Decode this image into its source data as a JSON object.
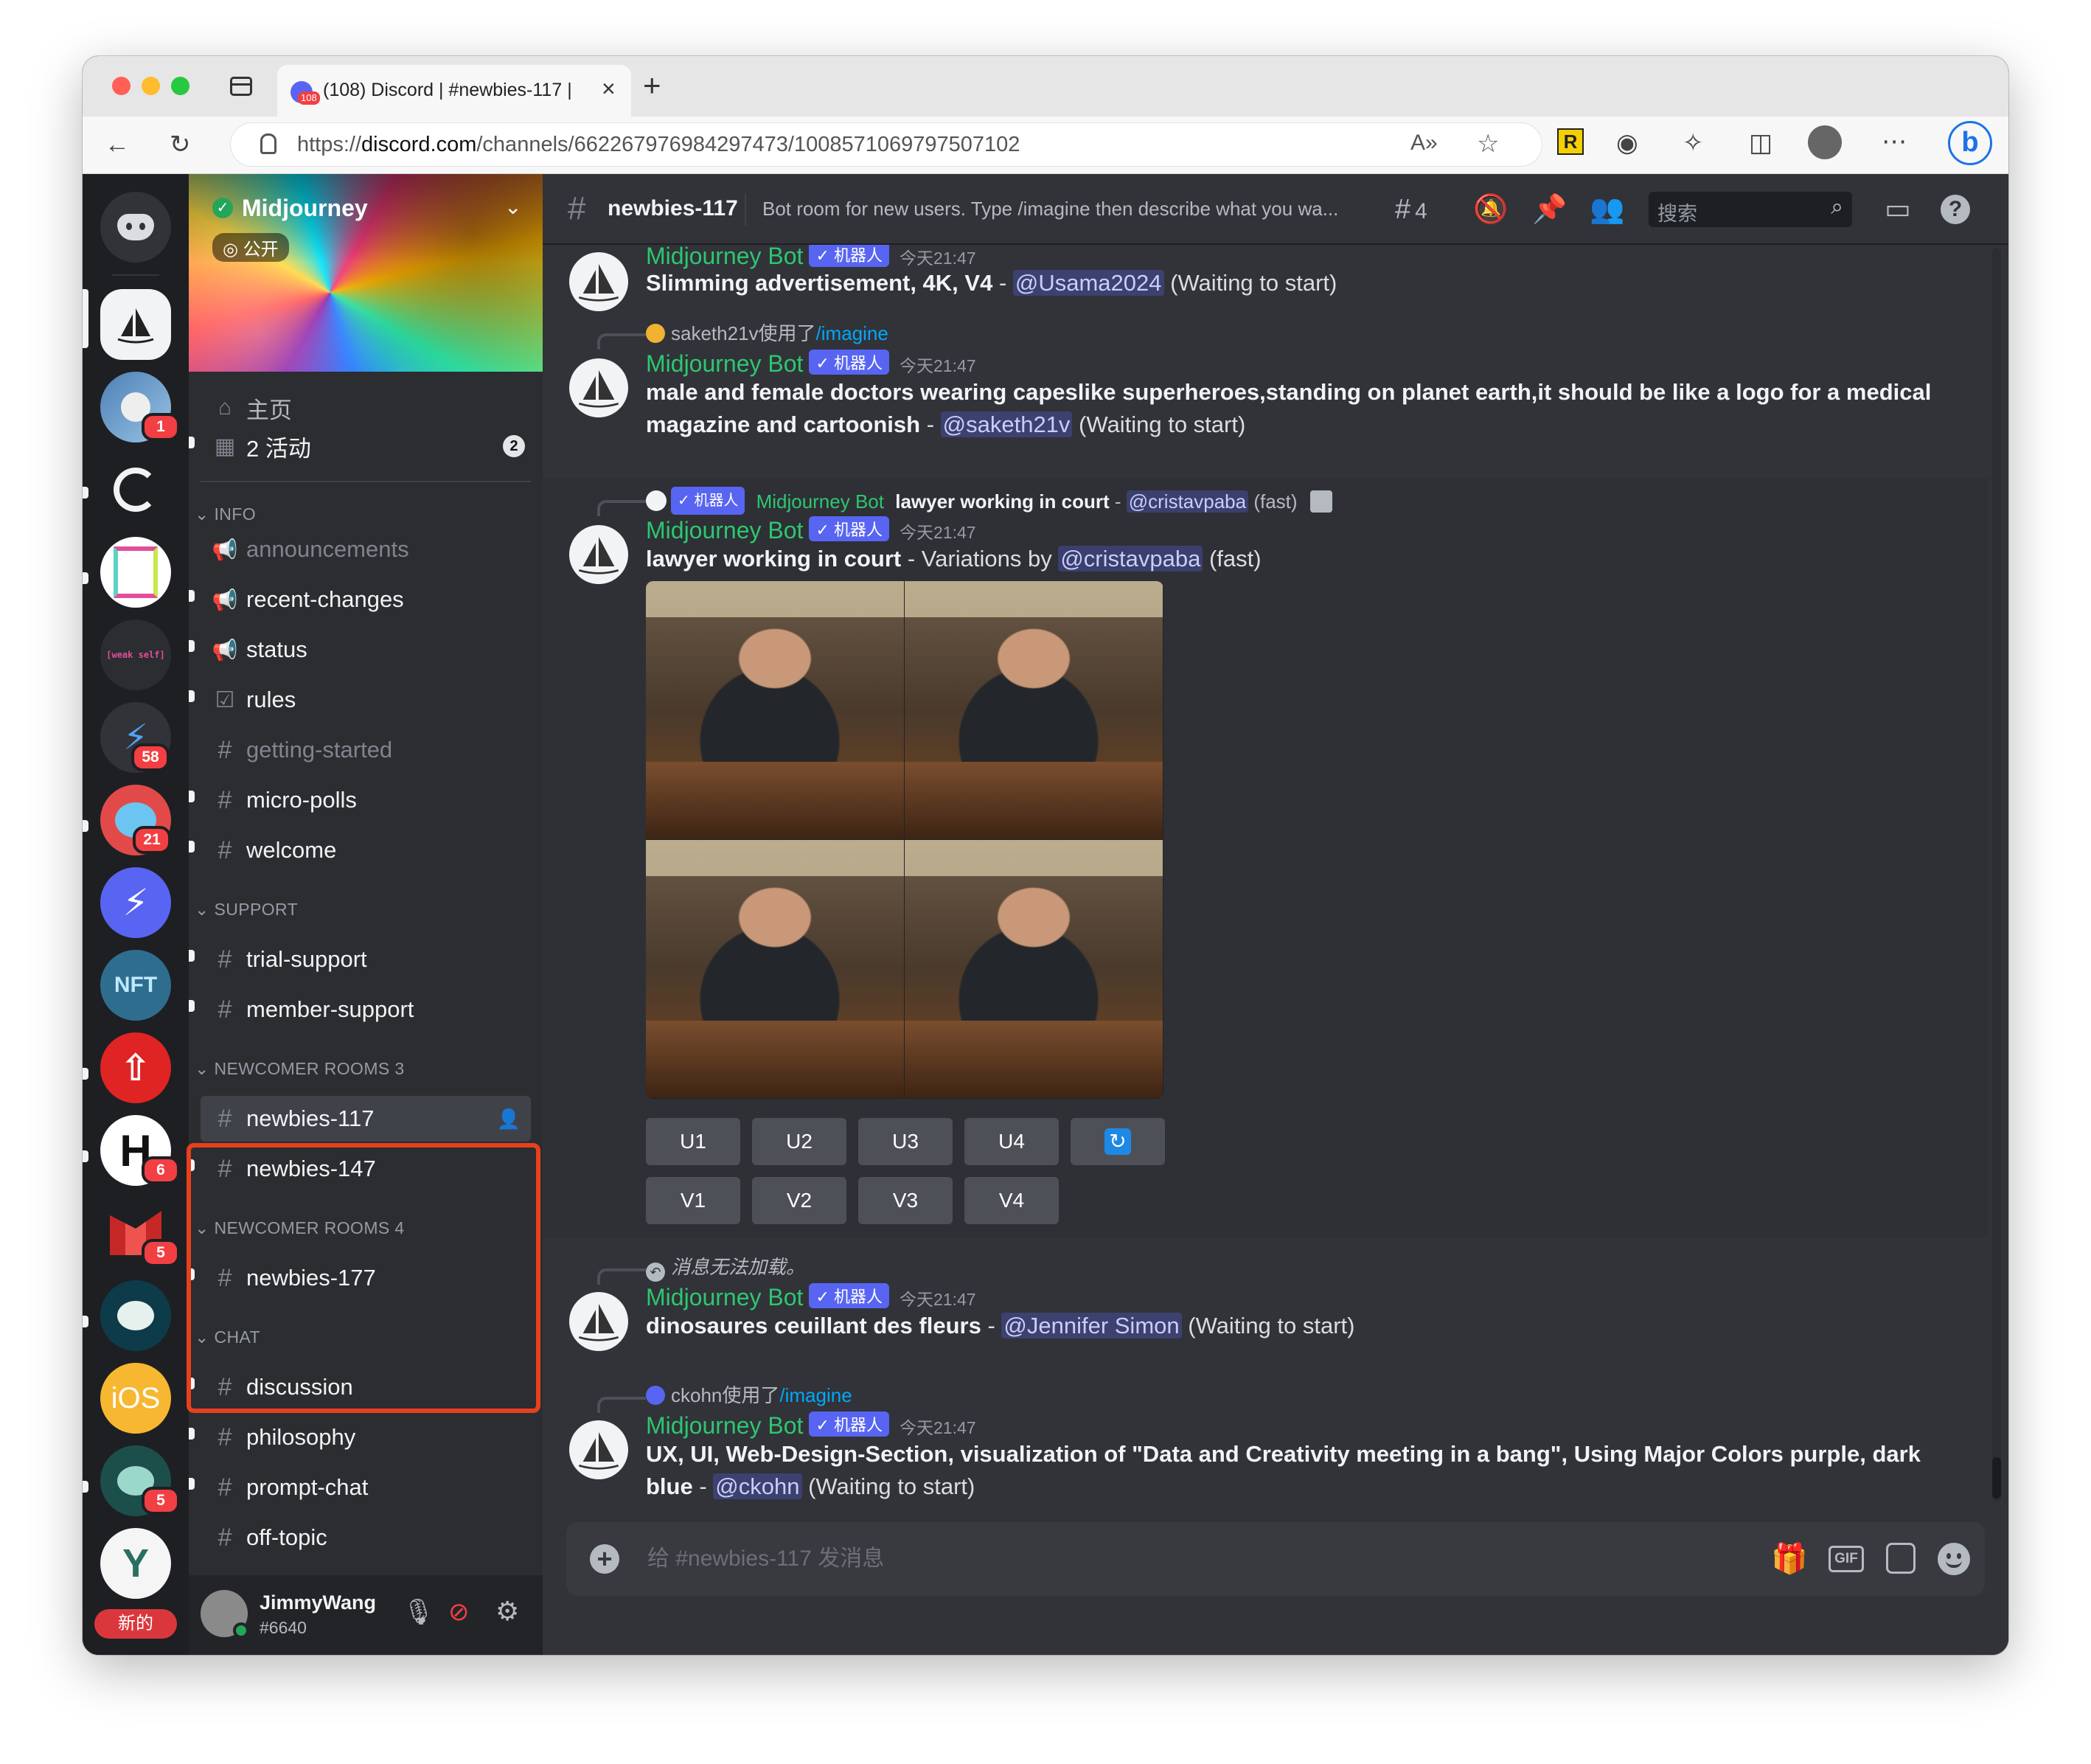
{
  "browser": {
    "tab_title": "(108) Discord | #newbies-117 |",
    "tab_badge": "108",
    "url_prefix": "https://",
    "url_host": "discord.com",
    "url_path": "/channels/662267976984297473/1008571069797507102"
  },
  "servers": [
    {
      "name": "Midjourney",
      "badge": ""
    },
    {
      "name": "astronaut",
      "badge": "1"
    },
    {
      "name": "swirl",
      "badge": ""
    },
    {
      "name": "pink-frame",
      "badge": ""
    },
    {
      "name": "weak-self",
      "label": "[weak self]",
      "badge": ""
    },
    {
      "name": "bolt",
      "badge": "58"
    },
    {
      "name": "cat",
      "badge": "21"
    },
    {
      "name": "bolt-blue",
      "badge": ""
    },
    {
      "name": "nft",
      "label": "NFT",
      "badge": ""
    },
    {
      "name": "red-arrow",
      "badge": ""
    },
    {
      "name": "h-server",
      "label": "H",
      "badge": "6"
    },
    {
      "name": "m-server",
      "badge": "5"
    },
    {
      "name": "paw",
      "badge": ""
    },
    {
      "name": "ios",
      "label": "iOS",
      "badge": ""
    },
    {
      "name": "paw-teal",
      "badge": "5"
    },
    {
      "name": "y-server",
      "badge": ""
    }
  ],
  "new_label": "新的",
  "server": {
    "name": "Midjourney",
    "visibility": "公开"
  },
  "nav": {
    "home": "主页",
    "events": "2 活动",
    "events_count": "2"
  },
  "categories": {
    "info": "INFO",
    "support": "SUPPORT",
    "newcomer3": "NEWCOMER ROOMS 3",
    "newcomer4": "NEWCOMER ROOMS 4",
    "chat": "CHAT"
  },
  "channels": {
    "announcements": "announcements",
    "recent_changes": "recent-changes",
    "status": "status",
    "rules": "rules",
    "getting_started": "getting-started",
    "micro_polls": "micro-polls",
    "welcome": "welcome",
    "trial_support": "trial-support",
    "member_support": "member-support",
    "newbies_117": "newbies-117",
    "newbies_147": "newbies-147",
    "newbies_177": "newbies-177",
    "discussion": "discussion",
    "philosophy": "philosophy",
    "prompt_chat": "prompt-chat",
    "off_topic": "off-topic"
  },
  "user": {
    "name": "JimmyWang",
    "tag": "#6640"
  },
  "header": {
    "channel": "newbies-117",
    "topic": "Bot room for new users. Type /imagine then describe what you wa...",
    "threads_count": "4",
    "search_placeholder": "搜索"
  },
  "bot": {
    "name": "Midjourney Bot",
    "tag": "✓ 机器人",
    "time": "今天21:47"
  },
  "messages": {
    "m0": {
      "prompt": "Slimming advertisement, 4K, V4",
      "sep": " - ",
      "mention": "@Usama2024",
      "status": " (Waiting to start)"
    },
    "m1": {
      "reply_user": "saketh21v使用了",
      "reply_cmd": "/imagine",
      "prompt": "male and female doctors wearing capeslike superheroes,standing on planet earth,it should be like a logo for a medical magazine and cartoonish",
      "sep": " - ",
      "mention": "@saketh21v",
      "status": " (Waiting to start)"
    },
    "m2": {
      "reply_name": "Midjourney Bot",
      "reply_prompt": "lawyer working in court",
      "reply_sep": " - ",
      "reply_mention": "@cristavpaba",
      "reply_status": " (fast)",
      "prompt": "lawyer working in court",
      "variations": " - Variations by ",
      "mention": "@cristavpaba",
      "status": " (fast)"
    },
    "m3": {
      "reply": "消息无法加载。",
      "prompt": "dinosaures ceuillant des fleurs",
      "sep": " - ",
      "mention": "@Jennifer Simon",
      "status": " (Waiting to start)"
    },
    "m4": {
      "reply_user": "ckohn使用了",
      "reply_cmd": "/imagine",
      "prompt": "UX, UI, Web-Design-Section, visualization of \"Data and Creativity meeting in a bang\", Using Major Colors purple, dark blue",
      "sep": " - ",
      "mention": "@ckohn",
      "status": " (Waiting to start)"
    }
  },
  "buttons": {
    "u1": "U1",
    "u2": "U2",
    "u3": "U3",
    "u4": "U4",
    "v1": "V1",
    "v2": "V2",
    "v3": "V3",
    "v4": "V4"
  },
  "composer": {
    "placeholder": "给 #newbies-117 发消息"
  },
  "colors": {
    "accent": "#5865f2",
    "bot_name": "#2dc770",
    "highlight_box": "#e8401c",
    "badge": "#f23f43"
  }
}
